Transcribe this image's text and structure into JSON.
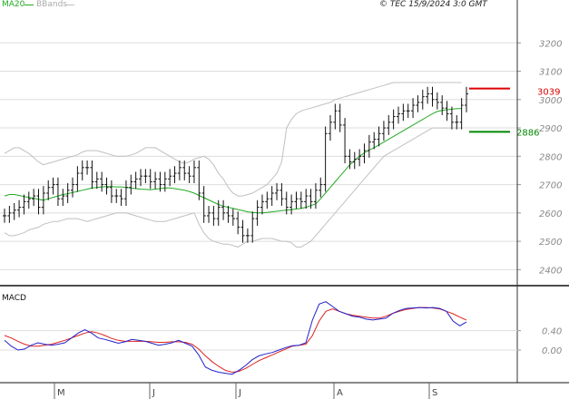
{
  "header": {
    "legend_ma": "MA20",
    "legend_bands": "BBands",
    "copyright": "© TEC 15/9/2024 3:0 GMT"
  },
  "colors": {
    "price": "#111111",
    "ma": "#22aa22",
    "bands": "#c0c0c0",
    "resistance": "#dd0000",
    "support": "#008800",
    "macd": "#2222cc",
    "signal": "#dd2222",
    "grid": "#dddddd",
    "tick": "#888888"
  },
  "chart_data": [
    {
      "type": "line",
      "subtype": "ohlc-bars",
      "title": "",
      "legend": [
        "MA20",
        "BBands"
      ],
      "yaxis": {
        "position": "right",
        "ylim": [
          2350,
          3300
        ],
        "ticks": [
          2400,
          2500,
          2600,
          2700,
          2800,
          2900,
          3000,
          3100,
          3200
        ]
      },
      "xaxis": {
        "month_labels": [
          "M",
          "J",
          "J",
          "A",
          "S"
        ]
      },
      "price_close": [
        2590,
        2600,
        2610,
        2620,
        2640,
        2650,
        2660,
        2620,
        2670,
        2690,
        2700,
        2650,
        2660,
        2680,
        2700,
        2740,
        2760,
        2760,
        2710,
        2720,
        2700,
        2690,
        2660,
        2660,
        2650,
        2690,
        2710,
        2720,
        2730,
        2730,
        2710,
        2720,
        2700,
        2720,
        2730,
        2740,
        2760,
        2740,
        2730,
        2760,
        2670,
        2590,
        2600,
        2580,
        2620,
        2600,
        2590,
        2580,
        2550,
        2520,
        2520,
        2580,
        2620,
        2640,
        2650,
        2670,
        2680,
        2650,
        2620,
        2640,
        2650,
        2640,
        2660,
        2640,
        2680,
        2700,
        2880,
        2920,
        2960,
        2910,
        2800,
        2780,
        2790,
        2800,
        2820,
        2850,
        2860,
        2880,
        2900,
        2920,
        2940,
        2950,
        2960,
        2960,
        2980,
        2990,
        3010,
        3020,
        3000,
        2990,
        2970,
        2950,
        2920,
        2920,
        2980,
        3020
      ],
      "ma20": [
        2660,
        2665,
        2665,
        2662,
        2658,
        2655,
        2652,
        2648,
        2645,
        2650,
        2655,
        2660,
        2665,
        2668,
        2672,
        2676,
        2680,
        2684,
        2688,
        2690,
        2692,
        2693,
        2693,
        2692,
        2692,
        2690,
        2688,
        2686,
        2684,
        2683,
        2682,
        2684,
        2686,
        2688,
        2688,
        2686,
        2683,
        2680,
        2676,
        2670,
        2662,
        2654,
        2646,
        2638,
        2630,
        2624,
        2620,
        2616,
        2612,
        2608,
        2604,
        2602,
        2600,
        2600,
        2602,
        2604,
        2606,
        2608,
        2610,
        2612,
        2614,
        2616,
        2620,
        2626,
        2632,
        2650,
        2670,
        2690,
        2710,
        2730,
        2750,
        2770,
        2785,
        2800,
        2812,
        2822,
        2830,
        2840,
        2850,
        2860,
        2870,
        2880,
        2890,
        2900,
        2910,
        2920,
        2930,
        2940,
        2950,
        2958,
        2962,
        2964,
        2966,
        2968,
        2968
      ],
      "band_upper": [
        2810,
        2820,
        2830,
        2830,
        2820,
        2810,
        2795,
        2780,
        2770,
        2775,
        2780,
        2785,
        2790,
        2795,
        2800,
        2805,
        2815,
        2820,
        2820,
        2820,
        2815,
        2810,
        2805,
        2800,
        2800,
        2800,
        2805,
        2810,
        2820,
        2830,
        2830,
        2830,
        2820,
        2810,
        2800,
        2790,
        2780,
        2775,
        2780,
        2790,
        2795,
        2800,
        2790,
        2770,
        2740,
        2720,
        2690,
        2670,
        2660,
        2660,
        2665,
        2670,
        2680,
        2690,
        2700,
        2720,
        2740,
        2780,
        2900,
        2930,
        2950,
        2960,
        2965,
        2970,
        2975,
        2980,
        2985,
        2990,
        3000,
        3005,
        3010,
        3015,
        3020,
        3025,
        3030,
        3035,
        3040,
        3045,
        3050,
        3055,
        3060,
        3060,
        3060,
        3060,
        3060,
        3060,
        3060,
        3060,
        3060,
        3060,
        3060,
        3060,
        3060,
        3060,
        3060
      ],
      "band_lower": [
        2530,
        2520,
        2520,
        2525,
        2530,
        2540,
        2545,
        2550,
        2560,
        2565,
        2570,
        2570,
        2575,
        2580,
        2580,
        2580,
        2575,
        2570,
        2575,
        2580,
        2585,
        2590,
        2595,
        2600,
        2600,
        2600,
        2595,
        2590,
        2585,
        2580,
        2575,
        2570,
        2570,
        2570,
        2575,
        2580,
        2585,
        2590,
        2595,
        2600,
        2560,
        2530,
        2510,
        2500,
        2495,
        2490,
        2490,
        2485,
        2480,
        2490,
        2500,
        2500,
        2505,
        2510,
        2510,
        2510,
        2505,
        2500,
        2500,
        2495,
        2480,
        2480,
        2490,
        2500,
        2520,
        2540,
        2560,
        2580,
        2600,
        2620,
        2640,
        2660,
        2680,
        2700,
        2720,
        2740,
        2760,
        2780,
        2800,
        2810,
        2820,
        2830,
        2840,
        2850,
        2860,
        2870,
        2880,
        2890,
        2900,
        2900,
        2900,
        2900,
        2900,
        2900,
        2900
      ],
      "resistance": {
        "value": 3039,
        "label": "3039"
      },
      "support": {
        "value": 2886,
        "label": "2886"
      }
    },
    {
      "type": "line",
      "title": "",
      "panel_label": "MACD",
      "yaxis": {
        "position": "right",
        "ylim": [
          -60,
          120
        ],
        "ticks": [
          0,
          40
        ],
        "tick_labels": [
          "0.00",
          "0.40"
        ]
      },
      "series": [
        {
          "name": "MACD",
          "values": [
            20,
            8,
            0,
            2,
            10,
            15,
            12,
            10,
            12,
            15,
            25,
            35,
            42,
            35,
            25,
            22,
            18,
            14,
            17,
            22,
            20,
            18,
            14,
            10,
            12,
            15,
            20,
            14,
            8,
            -10,
            -35,
            -42,
            -46,
            -48,
            -50,
            -42,
            -32,
            -20,
            -12,
            -8,
            -5,
            0,
            5,
            9,
            10,
            15,
            62,
            95,
            100,
            90,
            80,
            75,
            70,
            68,
            64,
            62,
            64,
            66,
            76,
            82,
            86,
            87,
            88,
            87,
            88,
            86,
            80,
            60,
            50,
            58
          ]
        },
        {
          "name": "Signal",
          "values": [
            30,
            25,
            18,
            12,
            8,
            8,
            10,
            12,
            16,
            20,
            25,
            30,
            35,
            38,
            35,
            30,
            24,
            20,
            18,
            18,
            18,
            18,
            17,
            16,
            16,
            17,
            17,
            16,
            12,
            2,
            -12,
            -24,
            -34,
            -42,
            -46,
            -44,
            -38,
            -30,
            -22,
            -16,
            -10,
            -4,
            2,
            8,
            10,
            12,
            30,
            60,
            80,
            85,
            80,
            75,
            72,
            70,
            68,
            66,
            66,
            70,
            76,
            80,
            84,
            86,
            88,
            88,
            87,
            85,
            80,
            75,
            68,
            62
          ]
        }
      ]
    }
  ]
}
